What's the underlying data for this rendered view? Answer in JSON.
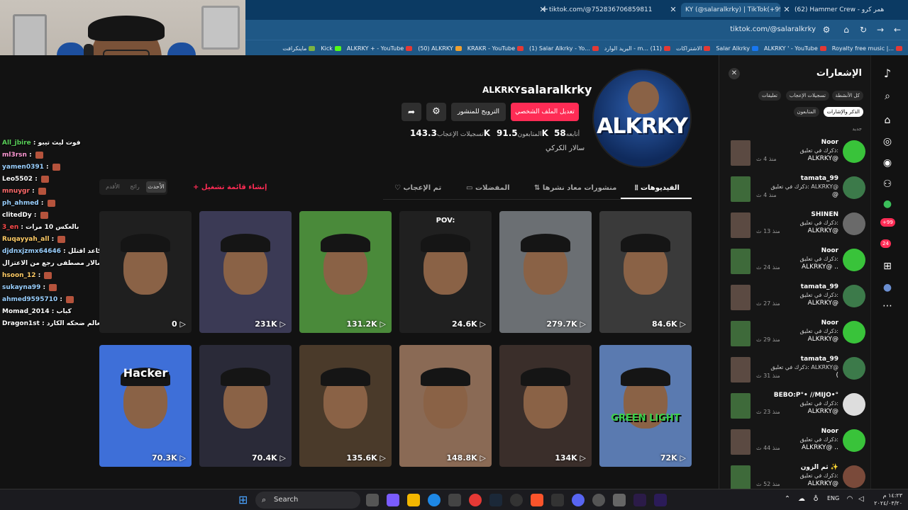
{
  "browser": {
    "tabs": [
      {
        "label": "tiktok.com/@752836706859811",
        "active": false
      },
      {
        "label": "KY (@salaralkrky) | TikTok(+99)",
        "active": true
      },
      {
        "label": "(62) Hammer Crew - همر كرو",
        "active": false
      }
    ],
    "address": "tiktok.com/@salaralkrky",
    "bookmarks": [
      {
        "label": "Royalty free music |...",
        "color": "#e53935"
      },
      {
        "label": "ALKRKY ' - YouTube",
        "color": "#e53935"
      },
      {
        "label": "Salar Alkrky",
        "color": "#1877f2"
      },
      {
        "label": "الاشتراكات",
        "color": "#e53935"
      },
      {
        "label": "البريد الوارد - m... (11)",
        "color": "#e53935"
      },
      {
        "label": "(1) Salar Alkrky - Yo...",
        "color": "#e53935"
      },
      {
        "label": "KRAKR - YouTube",
        "color": "#e53935"
      },
      {
        "label": "(50) ALKRKY",
        "color": "#f0a030"
      },
      {
        "label": "ALKRKY + - YouTube",
        "color": "#e53935"
      },
      {
        "label": "Kick",
        "color": "#53fc18"
      },
      {
        "label": "ماينكرافت",
        "color": "#7cb342"
      }
    ]
  },
  "chat": [
    {
      "user": "All_jbire",
      "msg": "فوت ليث تيبو",
      "color": "#5ad15a"
    },
    {
      "user": "ml3rsn",
      "msg": "",
      "color": "#ff9ad5"
    },
    {
      "user": "yamen0391",
      "msg": "",
      "color": "#9ad0ff"
    },
    {
      "user": "Leo5502",
      "msg": "",
      "color": "#ffffff"
    },
    {
      "user": "mnuygr",
      "msg": "",
      "color": "#ff6b6b"
    },
    {
      "user": "ph_ahmed",
      "msg": "",
      "color": "#9ad0ff"
    },
    {
      "user": "clitedDy",
      "msg": "",
      "color": "#ffffff"
    },
    {
      "user": "3_en",
      "msg": "بالعكس 10 مرات",
      "color": "#ff4b4b"
    },
    {
      "user": "Ruqayyah_all",
      "msg": "",
      "color": "#ffcc66"
    },
    {
      "user": "djdnxjzmx64646",
      "msg": "كاعد اقتلل",
      "color": "#9ad0ff"
    },
    {
      "user": "",
      "msg": "سالار مصطفى رجع من الاعتزال",
      "color": "#ffffff"
    },
    {
      "user": "hsoon_12",
      "msg": "",
      "color": "#ffcc66"
    },
    {
      "user": "sukayna99",
      "msg": "",
      "color": "#9ad0ff"
    },
    {
      "user": "ahmed9595710",
      "msg": "",
      "color": "#9ad0ff"
    },
    {
      "user": "Momad_2014",
      "msg": "كباب",
      "color": "#ffffff"
    },
    {
      "user": "Dragon1st",
      "msg": "احس ضحكه بالعالم ضحكه الكارد",
      "color": "#ffffff"
    }
  ],
  "profile": {
    "username": "salaralkrky",
    "nickname": "ALKRKY",
    "avatar_text": "ALKRKY",
    "buttons": {
      "edit": "تعديل الملف الشخصي",
      "promote": "الترويج للمنشور"
    },
    "stats": [
      {
        "value": "58",
        "label": "أتابعه"
      },
      {
        "value": "91.5K",
        "label": "المتابعون"
      },
      {
        "value": "143.3K",
        "label": "تسجيلات الإعجاب"
      }
    ],
    "bio": "سالار الكركي",
    "tabs": [
      {
        "label": "الفيديوهات",
        "active": true
      },
      {
        "label": "منشورات معاد نشرها",
        "active": false
      },
      {
        "label": "المفضلات",
        "active": false
      },
      {
        "label": "تم الإعجاب",
        "active": false
      }
    ],
    "create_playlist": "+ إنشاء قائمة تشغيل",
    "sort": [
      {
        "label": "الأحدث",
        "active": true
      },
      {
        "label": "رائج",
        "active": false
      },
      {
        "label": "الأقدم",
        "active": false
      }
    ]
  },
  "videos": [
    {
      "views": "84.6K",
      "overlay": "",
      "bg": "#3a3a3a"
    },
    {
      "views": "279.7K",
      "overlay": "",
      "bg": "#6b6f73"
    },
    {
      "views": "24.6K",
      "overlay": "POV:",
      "bg": "#202020"
    },
    {
      "views": "131.2K",
      "overlay": "",
      "bg": "#4a8a3a"
    },
    {
      "views": "231K",
      "overlay": "",
      "bg": "#3b3a55"
    },
    {
      "views": "0",
      "overlay": "",
      "bg": "#1f1f1f"
    },
    {
      "views": "72K",
      "overlay": "GREEN LIGHT",
      "bg": "#5a7ab0"
    },
    {
      "views": "134K",
      "overlay": "",
      "bg": "#3a2e2a"
    },
    {
      "views": "148.8K",
      "overlay": "",
      "bg": "#8a6a55"
    },
    {
      "views": "135.6K",
      "overlay": "",
      "bg": "#4a3a2a"
    },
    {
      "views": "70.4K",
      "overlay": "",
      "bg": "#2a2a38"
    },
    {
      "views": "70.3K",
      "overlay": "Hacker",
      "bg": "#3e6fd8"
    }
  ],
  "notifications": {
    "title": "الإشعارات",
    "chips": [
      {
        "label": "كل الأنشطة",
        "active": false
      },
      {
        "label": "تسجيلات الإعجاب",
        "active": false
      },
      {
        "label": "تعليقات",
        "active": false
      },
      {
        "label": "الذكر والإشارات",
        "active": true
      },
      {
        "label": "المتابعون",
        "active": false
      }
    ],
    "section": "جديد",
    "items": [
      {
        "name": "Noor",
        "text": "ذكرك في تعليق:",
        "mention": "ALKRKY@",
        "time": "منذ 4 ث",
        "avatar": "#39c33a"
      },
      {
        "name": "tamata_99",
        "text": "ذكرك في تعليق: ALKRKY@",
        "mention": "@",
        "time": "منذ 4 ث",
        "avatar": "#3c7a4a"
      },
      {
        "name": "SHINEN",
        "text": "ذكرك في تعليق:",
        "mention": "ALKRKY@",
        "time": "منذ 13 ث",
        "avatar": "#6a6a6a"
      },
      {
        "name": "Noor",
        "text": "ذكرك في تعليق:",
        "mention": "ALKRKY@ ..",
        "time": "منذ 24 ث",
        "avatar": "#39c33a"
      },
      {
        "name": "tamata_99",
        "text": "ذكرك في تعليق:",
        "mention": "ALKRKY@",
        "time": "منذ 27 ث",
        "avatar": "#3c7a4a"
      },
      {
        "name": "Noor",
        "text": "ذكرك في تعليق:",
        "mention": "ALKRKY@",
        "time": "منذ 29 ث",
        "avatar": "#39c33a"
      },
      {
        "name": "tamata_99",
        "text": "ذكرك في تعليق: ALKRKY@",
        "mention": "(",
        "time": "منذ 31 ث",
        "avatar": "#3c7a4a"
      },
      {
        "name": "BEBO:P°• //MIJO•°",
        "text": "ذكرك في تعليق:",
        "mention": "ALKRKY@",
        "time": "منذ 23 ث",
        "avatar": "#dddddd"
      },
      {
        "name": "Noor",
        "text": "ذكرك في تعليق:",
        "mention": "ALKRKY@ ..",
        "time": "منذ 44 ث",
        "avatar": "#39c33a"
      },
      {
        "name": "ثم الزون ✨",
        "text": "ذكرك في تعليق:",
        "mention": "ALKRKY@",
        "time": "منذ 52 ث",
        "avatar": "#7a4a3a"
      }
    ]
  },
  "rail": {
    "badge_inbox": "+99",
    "badge_msgs": "24"
  },
  "taskbar": {
    "search": "Search",
    "lang": "ENG",
    "time": "١٤:٢٣ م",
    "date": "٢٠٢٤/٠٣/٢٠"
  }
}
